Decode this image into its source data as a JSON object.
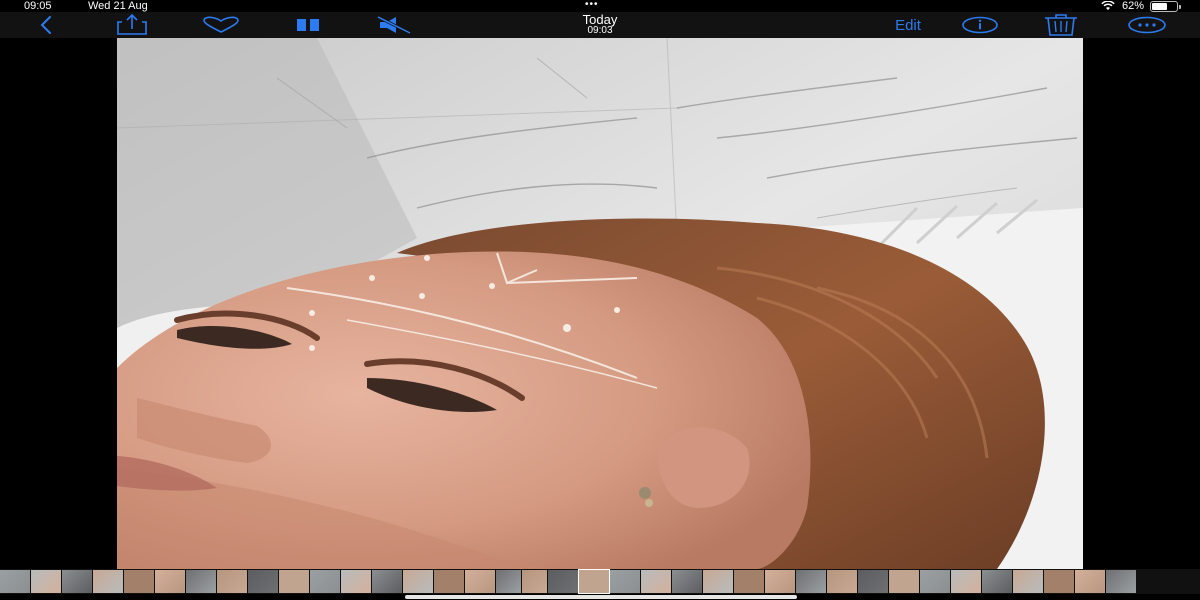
{
  "status_bar": {
    "time": "09:05",
    "date": "Wed 21 Aug",
    "dots": "•••",
    "battery_percent": "62%",
    "battery_level": 0.62
  },
  "toolbar": {
    "title": "Today",
    "subtitle": "09:03",
    "edit_label": "Edit",
    "icons": [
      "back-chevron-icon",
      "share-icon",
      "heart-icon",
      "pause-icon",
      "mute-icon",
      "info-icon",
      "trash-icon",
      "more-icon"
    ],
    "accent_color": "#2d7bf0"
  },
  "photo": {
    "subject": "photo-viewer-image"
  },
  "filmstrip": {
    "thumbnail_count": 37
  }
}
